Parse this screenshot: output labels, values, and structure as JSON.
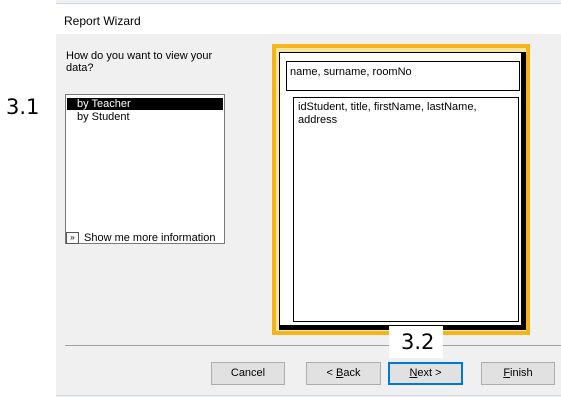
{
  "window": {
    "title": "Report Wizard"
  },
  "question": "How do you want to view your data?",
  "list": {
    "items": [
      {
        "label": "by Teacher",
        "selected": true
      },
      {
        "label": "by Student",
        "selected": false
      }
    ]
  },
  "more_info": {
    "icon": "chevron-double-right-icon",
    "label": "Show me more information"
  },
  "preview": {
    "group_fields": "name, surname, roomNo",
    "detail_fields": "idStudent, title, firstName, lastName, address"
  },
  "buttons": {
    "cancel": "Cancel",
    "back_arrow": "< ",
    "back_hotkey": "B",
    "back_rest": "ack",
    "next_hotkey": "N",
    "next_rest": "ext >",
    "finish_hotkey": "F",
    "finish_rest": "inish"
  },
  "annotations": {
    "label_1": "3.1",
    "label_2": "3.2"
  },
  "colors": {
    "preview_border": "#f5b41a",
    "preview_fill": "#fbe3a0",
    "selection": "#000000",
    "default_button": "#0078d7"
  }
}
